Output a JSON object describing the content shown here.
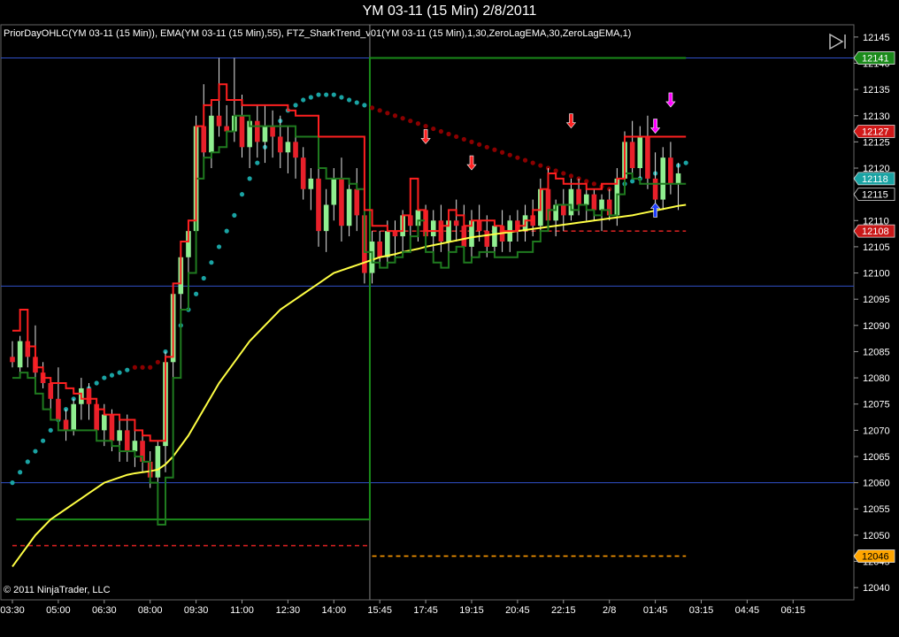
{
  "window": {
    "title": "YM 03-11 (15 Min)  2/8/2011",
    "indicators": "PriorDayOHLC(YM 03-11 (15 Min)), EMA(YM 03-11 (15 Min),55), FTZ_SharkTrend_v01(YM 03-11 (15 Min),1,30,ZeroLagEMA,30,ZeroLagEMA,1)",
    "copyright": "© 2011 NinjaTrader, LLC",
    "collapse_icon": "play-bar-icon"
  },
  "colors": {
    "background": "#000000",
    "up_candle": "#90ee90",
    "down_candle": "#e8202a",
    "ema": "#ffff44",
    "shark_red": "#ff2020",
    "shark_green": "#1f7a1f",
    "dots_teal": "#1aa3a3",
    "dots_dark_red": "#8b0000",
    "ref_green": "#1a8a1a",
    "blue_line": "#3050c8",
    "dashed_red": "#d02020",
    "dashed_orange": "#ff9a00",
    "arrow_red": "#ff2222",
    "arrow_magenta": "#ff00ff",
    "arrow_blue": "#2040ff"
  },
  "chart_data": {
    "type": "candlestick",
    "y_axis": {
      "range": [
        12038,
        12147
      ],
      "ticks": [
        12040,
        12045,
        12050,
        12055,
        12060,
        12065,
        12070,
        12075,
        12080,
        12085,
        12090,
        12095,
        12100,
        12105,
        12110,
        12115,
        12120,
        12125,
        12130,
        12135,
        12140,
        12145
      ]
    },
    "x_axis": {
      "range": [
        0,
        95
      ],
      "ticks": [
        {
          "bar": 0,
          "label": "03:30"
        },
        {
          "bar": 6,
          "label": "05:00"
        },
        {
          "bar": 12,
          "label": "06:30"
        },
        {
          "bar": 18,
          "label": "08:00"
        },
        {
          "bar": 24,
          "label": "09:30"
        },
        {
          "bar": 30,
          "label": "11:00"
        },
        {
          "bar": 36,
          "label": "12:30"
        },
        {
          "bar": 42,
          "label": "14:00"
        },
        {
          "bar": 48,
          "label": "15:45"
        },
        {
          "bar": 54,
          "label": "17:45"
        },
        {
          "bar": 60,
          "label": "19:15"
        },
        {
          "bar": 66,
          "label": "20:45"
        },
        {
          "bar": 72,
          "label": "22:15"
        },
        {
          "bar": 78,
          "label": "2/8"
        },
        {
          "bar": 84,
          "label": "01:45"
        },
        {
          "bar": 90,
          "label": "03:15"
        },
        {
          "bar": 96,
          "label": "04:45"
        },
        {
          "bar": 102,
          "label": "06:15"
        }
      ]
    },
    "price_badges": [
      {
        "value": 12141,
        "label": "12141",
        "color": "#1a8a1a"
      },
      {
        "value": 12127,
        "label": "12127",
        "color": "#d01818"
      },
      {
        "value": 12118,
        "label": "12118",
        "color": "#1aa3a3"
      },
      {
        "value": 12115,
        "label": "12115",
        "color": "#000000"
      },
      {
        "value": 12108,
        "label": "12108",
        "color": "#c81818"
      },
      {
        "value": 12046,
        "label": "12046",
        "color": "#ffa500"
      }
    ],
    "horizontal_lines": [
      {
        "value": 12141,
        "color": "#3050c8",
        "style": "solid"
      },
      {
        "value": 12097.5,
        "color": "#3050c8",
        "style": "solid"
      },
      {
        "value": 12060,
        "color": "#3050c8",
        "style": "solid"
      }
    ],
    "level_segments": [
      {
        "from_bar": 0,
        "to_bar": 46.7,
        "value": 12048,
        "color": "#d02020",
        "style": "dashed"
      },
      {
        "from_bar": 47,
        "to_bar": 88,
        "value": 12046,
        "color": "#ff9a00",
        "style": "dashed"
      },
      {
        "from_bar": 47,
        "to_bar": 88,
        "value": 12108,
        "color": "#d02020",
        "style": "dashed"
      }
    ],
    "session_divider_bar": 46.7,
    "prior_day_high": [
      {
        "from_bar": 0.5,
        "to_bar": 46.7,
        "value": 12053
      },
      {
        "from_bar": 46.7,
        "to_bar": 47.3,
        "value": 12141
      },
      {
        "from_bar": 47.3,
        "to_bar": 88,
        "value": 12141
      }
    ],
    "candles": [
      [
        12084,
        12087,
        12082,
        12083
      ],
      [
        12082,
        12088,
        12080,
        12087
      ],
      [
        12087,
        12089,
        12082,
        12084
      ],
      [
        12084,
        12090,
        12078,
        12081
      ],
      [
        12081,
        12083,
        12078,
        12079
      ],
      [
        12079,
        12080,
        12074,
        12076
      ],
      [
        12076,
        12082,
        12070,
        12072
      ],
      [
        12072,
        12074,
        12068,
        12070
      ],
      [
        12070,
        12076,
        12069,
        12075
      ],
      [
        12075,
        12080,
        12072,
        12078
      ],
      [
        12078,
        12079,
        12072,
        12075
      ],
      [
        12075,
        12076,
        12068,
        12070
      ],
      [
        12070,
        12075,
        12067,
        12073
      ],
      [
        12073,
        12074,
        12066,
        12068
      ],
      [
        12068,
        12072,
        12064,
        12070
      ],
      [
        12070,
        12073,
        12064,
        12066
      ],
      [
        12066,
        12070,
        12063,
        12068
      ],
      [
        12068,
        12069,
        12062,
        12064
      ],
      [
        12064,
        12066,
        12059,
        12061
      ],
      [
        12061,
        12068,
        12060,
        12067
      ],
      [
        12067,
        12085,
        12062,
        12083
      ],
      [
        12083,
        12098,
        12080,
        12096
      ],
      [
        12096,
        12105,
        12092,
        12103
      ],
      [
        12103,
        12110,
        12100,
        12108
      ],
      [
        12108,
        12130,
        12105,
        12128
      ],
      [
        12128,
        12136,
        12118,
        12123
      ],
      [
        12123,
        12132,
        12120,
        12130
      ],
      [
        12130,
        12141,
        12126,
        12128
      ],
      [
        12128,
        12132,
        12124,
        12127
      ],
      [
        12127,
        12141,
        12125,
        12130
      ],
      [
        12130,
        12134,
        12122,
        12124
      ],
      [
        12124,
        12130,
        12120,
        12129
      ],
      [
        12129,
        12132,
        12122,
        12125
      ],
      [
        12125,
        12132,
        12121,
        12128
      ],
      [
        12128,
        12131,
        12122,
        12126
      ],
      [
        12126,
        12130,
        12120,
        12123
      ],
      [
        12123,
        12128,
        12119,
        12125
      ],
      [
        12125,
        12128,
        12118,
        12122
      ],
      [
        12122,
        12124,
        12114,
        12116
      ],
      [
        12116,
        12120,
        12112,
        12118
      ],
      [
        12118,
        12121,
        12105,
        12108
      ],
      [
        12108,
        12116,
        12104,
        12113
      ],
      [
        12113,
        12120,
        12110,
        12118
      ],
      [
        12118,
        12122,
        12106,
        12109
      ],
      [
        12109,
        12118,
        12107,
        12116
      ],
      [
        12116,
        12120,
        12108,
        12111
      ],
      [
        12111,
        12114,
        12098,
        12100
      ],
      [
        12100,
        12108,
        12098,
        12106
      ],
      [
        12106,
        12108,
        12101,
        12103
      ],
      [
        12103,
        12110,
        12102,
        12108
      ],
      [
        12108,
        12110,
        12103,
        12107
      ],
      [
        12107,
        12112,
        12104,
        12111
      ],
      [
        12111,
        12112,
        12104,
        12109
      ],
      [
        12109,
        12116,
        12106,
        12112
      ],
      [
        12112,
        12113,
        12105,
        12107
      ],
      [
        12107,
        12112,
        12104,
        12110
      ],
      [
        12110,
        12113,
        12104,
        12106
      ],
      [
        12106,
        12112,
        12104,
        12110
      ],
      [
        12110,
        12114,
        12106,
        12109
      ],
      [
        12109,
        12113,
        12103,
        12105
      ],
      [
        12105,
        12112,
        12103,
        12110
      ],
      [
        12110,
        12113,
        12106,
        12108
      ],
      [
        12108,
        12111,
        12103,
        12105
      ],
      [
        12105,
        12110,
        12103,
        12109
      ],
      [
        12109,
        12112,
        12104,
        12106
      ],
      [
        12106,
        12111,
        12104,
        12110
      ],
      [
        12110,
        12112,
        12106,
        12108
      ],
      [
        12108,
        12113,
        12106,
        12111
      ],
      [
        12111,
        12114,
        12107,
        12109
      ],
      [
        12109,
        12118,
        12107,
        12116
      ],
      [
        12116,
        12120,
        12108,
        12110
      ],
      [
        12110,
        12114,
        12107,
        12113
      ],
      [
        12113,
        12116,
        12108,
        12111
      ],
      [
        12111,
        12118,
        12110,
        12116
      ],
      [
        12116,
        12118,
        12111,
        12113
      ],
      [
        12113,
        12117,
        12110,
        12115
      ],
      [
        12115,
        12116,
        12110,
        12112
      ],
      [
        12112,
        12115,
        12108,
        12114
      ],
      [
        12114,
        12116,
        12110,
        12111
      ],
      [
        12111,
        12120,
        12109,
        12118
      ],
      [
        12118,
        12127,
        12116,
        12125
      ],
      [
        12125,
        12129,
        12118,
        12120
      ],
      [
        12120,
        12128,
        12117,
        12126
      ],
      [
        12126,
        12130,
        12116,
        12118
      ],
      [
        12118,
        12123,
        12112,
        12114
      ],
      [
        12114,
        12124,
        12112,
        12122
      ],
      [
        12122,
        12125,
        12115,
        12117
      ],
      [
        12117,
        12121,
        12112,
        12119
      ]
    ],
    "ema_55": [
      12044,
      12046,
      12048,
      12050,
      12051.5,
      12053,
      12054,
      12055,
      12056,
      12057,
      12058,
      12059,
      12060,
      12060.5,
      12061,
      12061.5,
      12061.8,
      12062,
      12062.2,
      12062.5,
      12063.5,
      12065,
      12067,
      12069,
      12071.5,
      12074,
      12076.5,
      12079,
      12081,
      12083,
      12085,
      12087,
      12088.5,
      12090,
      12091.5,
      12093,
      12094,
      12095,
      12096,
      12097,
      12098,
      12099,
      12100,
      12100.5,
      12101,
      12101.5,
      12102,
      12102.5,
      12103,
      12103.3,
      12103.6,
      12104,
      12104.3,
      12104.6,
      12105,
      12105.3,
      12105.6,
      12105.9,
      12106.2,
      12106.5,
      12106.8,
      12107,
      12107.2,
      12107.4,
      12107.6,
      12107.8,
      12108,
      12108.2,
      12108.4,
      12108.6,
      12108.8,
      12109,
      12109.2,
      12109.4,
      12109.6,
      12109.8,
      12110,
      12110.2,
      12110.4,
      12110.6,
      12110.8,
      12111,
      12111.3,
      12111.6,
      12111.9,
      12112.2,
      12112.5,
      12112.8,
      12113
    ],
    "shark_upper": [
      12089,
      12093,
      12086,
      12082,
      12080,
      12079,
      12079,
      12078,
      12077,
      12076,
      12076,
      12074,
      12073,
      12073,
      12072,
      12072,
      12070,
      12069,
      12068,
      12068,
      12084,
      12098,
      12106,
      12110,
      12128,
      12132,
      12133,
      12136,
      12133,
      12133,
      12132,
      12132,
      12132,
      12132,
      12132,
      12132,
      12131,
      12130,
      12130,
      12130,
      12126,
      12126,
      12126,
      12126,
      12126,
      12126,
      12112,
      12109,
      12109,
      12108,
      12108,
      12111,
      12118,
      12112,
      12108,
      12108,
      12109,
      12112,
      12111,
      12109,
      12110,
      12110,
      12110,
      12109,
      12108,
      12108,
      12109,
      12110,
      12112,
      12116,
      12119,
      12118,
      12117,
      12117,
      12117,
      12116,
      12116,
      12117,
      12117,
      12118,
      12126,
      12126,
      12126,
      12126,
      12126,
      12126,
      12126,
      12126,
      12126
    ],
    "shark_lower": [
      12080,
      12081,
      12080,
      12077,
      12074,
      12072,
      12070,
      12070,
      12070,
      12070,
      12070,
      12068,
      12068,
      12067,
      12066,
      12066,
      12065,
      12064,
      12060,
      12052,
      12061,
      12080,
      12093,
      12100,
      12118,
      12122,
      12123,
      12124,
      12127,
      12130,
      12130,
      12128,
      12128,
      12128,
      12128,
      12128,
      12128,
      12126,
      12126,
      12126,
      12120,
      12118,
      12118,
      12118,
      12117,
      12116,
      12104,
      12102,
      12101,
      12102,
      12103,
      12104,
      12107,
      12110,
      12104,
      12102,
      12101,
      12104,
      12105,
      12102,
      12103,
      12104,
      12104,
      12103,
      12103,
      12103,
      12104,
      12104,
      12106,
      12108,
      12112,
      12113,
      12113,
      12112,
      12113,
      12112,
      12111,
      12112,
      12111,
      12115,
      12119,
      12118,
      12117,
      12117,
      12117,
      12117,
      12117,
      12117,
      12117
    ],
    "dots": [
      12060,
      12062,
      12064,
      12066,
      12068,
      12070,
      12072,
      12074,
      12076,
      12077,
      12078,
      12079,
      12080,
      12080.5,
      12081,
      12081.5,
      12082,
      12082,
      12082,
      12083,
      12085,
      12087,
      12090,
      12093,
      12096,
      12099,
      12102,
      12105,
      12108,
      12111,
      12115,
      12118,
      12121,
      12124,
      12127,
      12129,
      12131,
      12132,
      12133,
      12133.5,
      12134,
      12134,
      12134,
      12133.5,
      12133,
      12132.5,
      12132,
      12131.5,
      12131,
      12130.5,
      12130,
      12129.5,
      12129,
      12128.5,
      12128,
      12127.5,
      12127,
      12126.5,
      12126,
      12125.5,
      12125,
      12124.5,
      12124,
      12123.5,
      12123,
      12122.5,
      12122,
      12121.5,
      12121,
      12120.5,
      12120,
      12119.5,
      12119,
      12118.5,
      12118,
      12117.5,
      12117,
      12116.5,
      12116,
      12116.5,
      12117,
      12117.5,
      12118,
      12118.5,
      12119,
      12119.5,
      12120,
      12120.5,
      12121
    ],
    "dots_red_bars": [
      [
        16,
        19
      ],
      [
        47,
        79
      ]
    ],
    "signal_arrows": [
      {
        "bar": 54,
        "value": 12126,
        "direction": "down",
        "color": "#ff2222"
      },
      {
        "bar": 60,
        "value": 12121,
        "direction": "down",
        "color": "#ff2222"
      },
      {
        "bar": 73,
        "value": 12129,
        "direction": "down",
        "color": "#ff2222"
      },
      {
        "bar": 84,
        "value": 12128,
        "direction": "down",
        "color": "#ff00ff"
      },
      {
        "bar": 86,
        "value": 12133,
        "direction": "down",
        "color": "#ff00ff"
      },
      {
        "bar": 84,
        "value": 12112,
        "direction": "up",
        "color": "#2040ff"
      }
    ]
  }
}
